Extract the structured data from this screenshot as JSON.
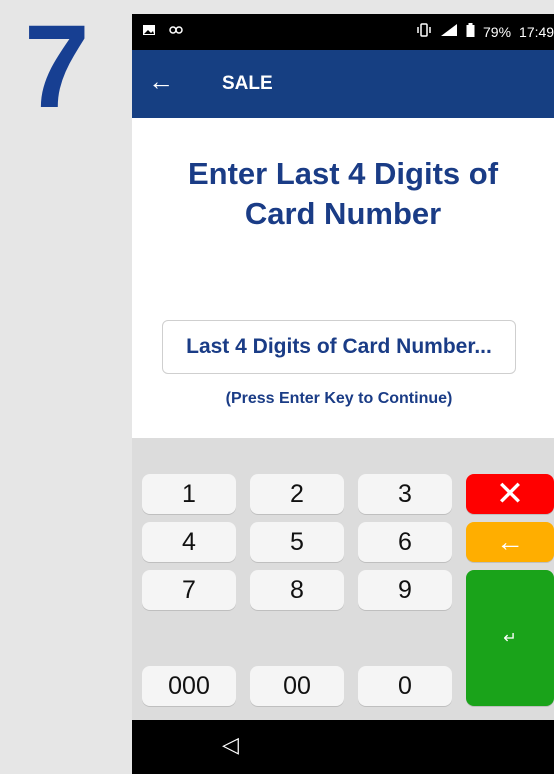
{
  "step": {
    "number": "7"
  },
  "status_bar": {
    "left_icons": [
      "image-icon",
      "link-icon"
    ],
    "right_icons": [
      "vibrate-icon",
      "signal-icon",
      "battery-icon"
    ],
    "battery": "79%",
    "time": "17:49"
  },
  "appbar": {
    "back_icon": "←",
    "title": "SALE"
  },
  "screen": {
    "heading_line1": "Enter Last 4 Digits of",
    "heading_line2": "Card Number",
    "input_placeholder": "Last 4 Digits of Card Number...",
    "hint": "(Press Enter Key to Continue)"
  },
  "keypad": {
    "keys": [
      "1",
      "2",
      "3",
      "4",
      "5",
      "6",
      "7",
      "8",
      "9",
      "000",
      "00",
      "0"
    ],
    "cancel": "✕",
    "backspace": "←",
    "enter": "↵"
  },
  "navbar": {
    "back": "◁"
  },
  "colors": {
    "appbar": "#163f82",
    "heading": "#1a3c86",
    "cancel": "#ff0000",
    "backspace": "#ffae00",
    "enter": "#1aa31a"
  }
}
